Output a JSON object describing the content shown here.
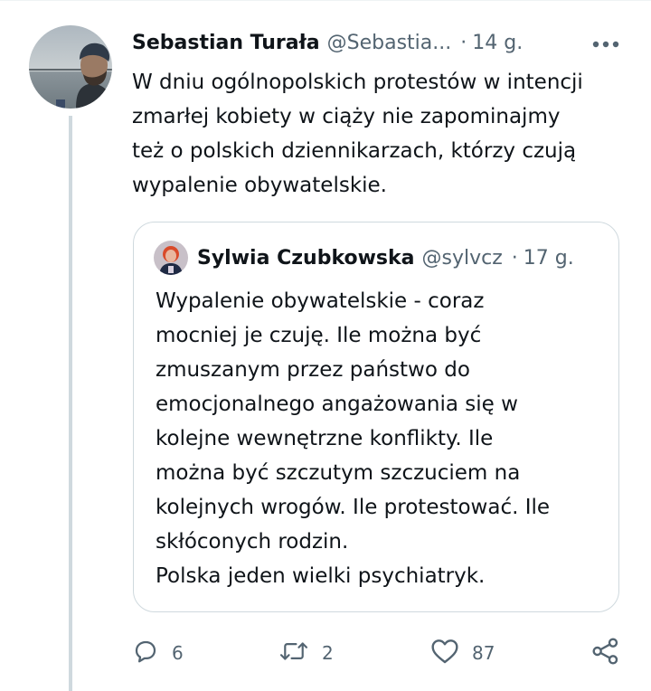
{
  "tweet": {
    "author_name": "Sebastian Turała",
    "author_handle": "@Sebastia...",
    "separator": "·",
    "time": "14 g.",
    "text": "W dniu ogólnopolskich protestów w intencji\nzmarłej kobiety w ciąży nie zapominajmy\nteż o polskich dziennikarzach, którzy czują\nwypalenie obywatelskie."
  },
  "quoted_tweet": {
    "author_name": "Sylwia Czubkowska",
    "author_handle": "@sylvcz",
    "separator": "·",
    "time": "17 g.",
    "text": "Wypalenie obywatelskie - coraz\nmocniej je czuję. Ile można być\nzmuszanym przez państwo do\nemocjonalnego angażowania się w\nkolejne wewnętrzne konflikty. Ile\nmożna być szczutym szczuciem na\nkolejnych wrogów. Ile protestować. Ile\nskłóconych rodzin.\nPolska jeden wielki psychiatryk."
  },
  "actions": {
    "reply_count": "6",
    "retweet_count": "2",
    "like_count": "87"
  },
  "icons": {
    "more": "more-dots-icon",
    "reply": "reply-bubble-icon",
    "retweet": "retweet-arrows-icon",
    "like": "heart-icon",
    "share": "share-icon"
  },
  "colors": {
    "text_primary": "#0f1419",
    "text_secondary": "#536471",
    "border": "#cfd9de",
    "thread_line": "#cfd9de"
  }
}
